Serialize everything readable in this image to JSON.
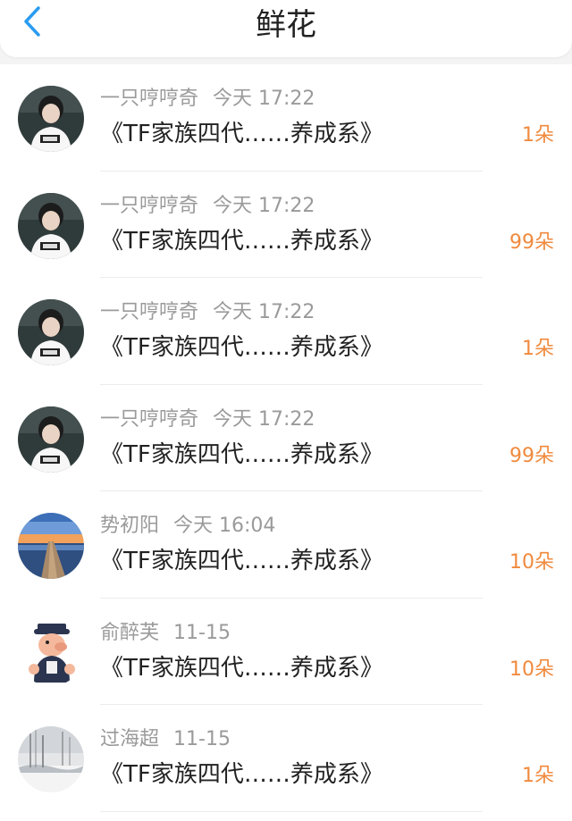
{
  "header": {
    "title": "鲜花",
    "back_icon": "chevron-left-icon",
    "accent_color": "#2a9cf0"
  },
  "colors": {
    "amount": "#f08a3e",
    "meta": "#9a9a9a",
    "text": "#222222"
  },
  "items": [
    {
      "name": "一只哼哼奇",
      "time": "今天 17:22",
      "message": "《TF家族四代……养成系》",
      "amount": "1朵",
      "avatar": "boy-avatar"
    },
    {
      "name": "一只哼哼奇",
      "time": "今天 17:22",
      "message": "《TF家族四代……养成系》",
      "amount": "99朵",
      "avatar": "boy-avatar"
    },
    {
      "name": "一只哼哼奇",
      "time": "今天 17:22",
      "message": "《TF家族四代……养成系》",
      "amount": "1朵",
      "avatar": "boy-avatar"
    },
    {
      "name": "一只哼哼奇",
      "time": "今天 17:22",
      "message": "《TF家族四代……养成系》",
      "amount": "99朵",
      "avatar": "boy-avatar"
    },
    {
      "name": "势初阳",
      "time": "今天 16:04",
      "message": "《TF家族四代……养成系》",
      "amount": "10朵",
      "avatar": "pier-lake-avatar"
    },
    {
      "name": "俞醉芙",
      "time": "11-15",
      "message": "《TF家族四代……养成系》",
      "amount": "10朵",
      "avatar": "pig-cartoon-avatar"
    },
    {
      "name": "过海超",
      "time": "11-15",
      "message": "《TF家族四代……养成系》",
      "amount": "1朵",
      "avatar": "winter-trees-avatar"
    }
  ]
}
